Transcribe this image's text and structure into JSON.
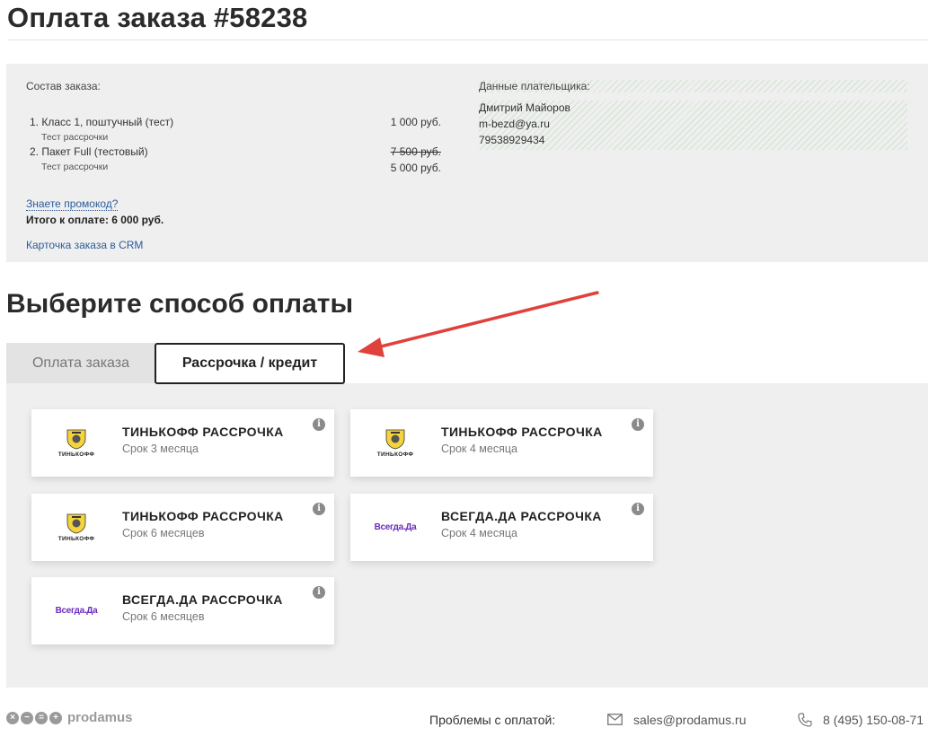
{
  "header": {
    "title": "Оплата заказа #58238"
  },
  "order": {
    "label": "Состав заказа:",
    "items": [
      {
        "name": "1. Класс 1, поштучный (тест)",
        "price": "1 000 руб.",
        "sub": "Тест рассрочки",
        "old_price": ""
      },
      {
        "name": "2. Пакет Full (тестовый)",
        "old_price": "7 500 руб.",
        "price": "5 000 руб.",
        "sub": "Тест рассрочки"
      }
    ],
    "promo_link": "Знаете промокод?",
    "total": "Итого к оплате: 6 000 руб.",
    "crm_link": "Карточка заказа в CRM"
  },
  "payer": {
    "label": "Данные плательщика:",
    "name": "Дмитрий Майоров",
    "email": "m-bezd@ya.ru",
    "phone": "79538929434"
  },
  "payment": {
    "title": "Выберите способ оплаты",
    "tabs": [
      {
        "label": "Оплата заказа",
        "active": false
      },
      {
        "label": "Рассрочка / кредит",
        "active": true
      }
    ],
    "options": [
      {
        "provider": "tinkoff",
        "logo_text": "ТИНЬКОФФ",
        "title": "ТИНЬКОФФ РАССРОЧКА",
        "term": "Срок 3 месяца"
      },
      {
        "provider": "tinkoff",
        "logo_text": "ТИНЬКОФФ",
        "title": "ТИНЬКОФФ РАССРОЧКА",
        "term": "Срок 4 месяца"
      },
      {
        "provider": "tinkoff",
        "logo_text": "ТИНЬКОФФ",
        "title": "ТИНЬКОФФ РАССРОЧКА",
        "term": "Срок 6 месяцев"
      },
      {
        "provider": "vsegda",
        "logo_text": "Всегда.Да",
        "title": "ВСЕГДА.ДА РАССРОЧКА",
        "term": "Срок 4 месяца"
      },
      {
        "provider": "vsegda",
        "logo_text": "Всегда.Да",
        "title": "ВСЕГДА.ДА РАССРОЧКА",
        "term": "Срок 6 месяцев"
      }
    ],
    "info_glyph": "i"
  },
  "footer": {
    "brand": "prodamus",
    "problems_label": "Проблемы с оплатой:",
    "email": "sales@prodamus.ru",
    "phone": "8 (495) 150-08-71"
  },
  "colors": {
    "link": "#2b5d9a",
    "arrow": "#e0413a",
    "panel_bg": "#efefef",
    "vsegda_purple": "#6a2bbf"
  }
}
